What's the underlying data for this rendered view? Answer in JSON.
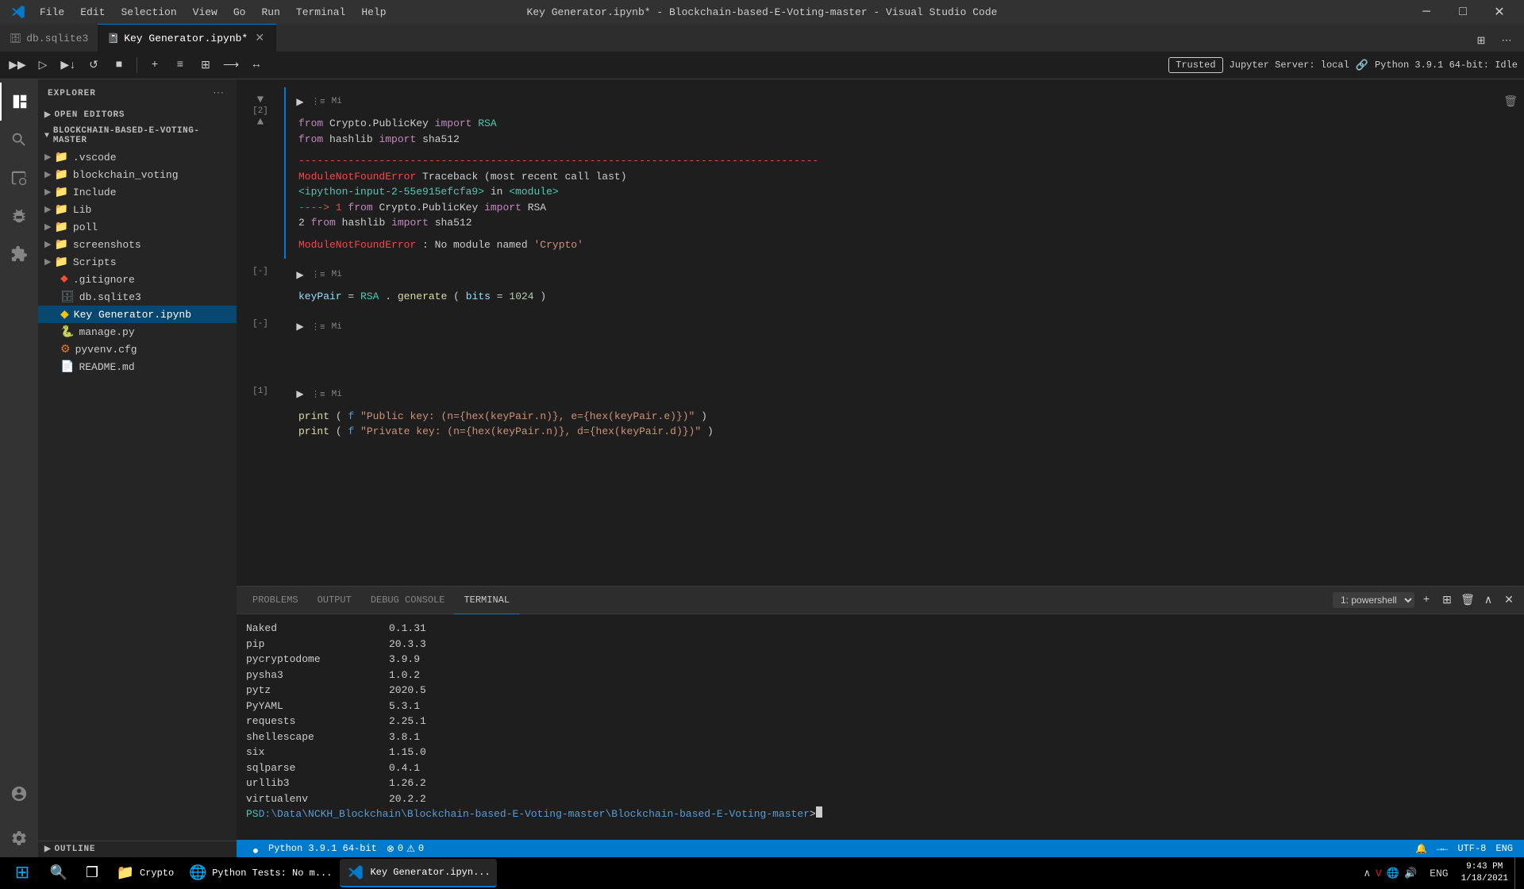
{
  "titleBar": {
    "title": "Key Generator.ipynb* - Blockchain-based-E-Voting-master - Visual Studio Code",
    "menuItems": [
      "File",
      "Edit",
      "Selection",
      "View",
      "Go",
      "Run",
      "Terminal",
      "Help"
    ],
    "windowControls": {
      "minimize": "─",
      "maximize": "□",
      "close": "✕"
    }
  },
  "tabs": {
    "items": [
      {
        "id": "db-tab",
        "label": "db.sqlite3",
        "icon": "🗄",
        "active": false,
        "modified": false
      },
      {
        "id": "keygen-tab",
        "label": "Key Generator.ipynb",
        "icon": "📓",
        "active": true,
        "modified": true
      }
    ],
    "rightActions": [
      "⋯",
      "⊞"
    ]
  },
  "notebookToolbar": {
    "buttons": [
      {
        "id": "run-all",
        "icon": "▶▶",
        "title": "Run All"
      },
      {
        "id": "run-above",
        "icon": "▶↑",
        "title": "Run Above"
      },
      {
        "id": "run-below",
        "icon": "▶↓",
        "title": "Run Below"
      },
      {
        "id": "restart",
        "icon": "↺",
        "title": "Restart"
      },
      {
        "id": "stop",
        "icon": "■",
        "title": "Stop"
      },
      {
        "id": "add-cell",
        "icon": "+",
        "title": "Add Cell"
      },
      {
        "id": "toggle-1",
        "icon": "≡",
        "title": "Toggle"
      },
      {
        "id": "toggle-2",
        "icon": "⊞",
        "title": "Toggle 2"
      },
      {
        "id": "toggle-3",
        "icon": "⟶",
        "title": "Toggle 3"
      },
      {
        "id": "split",
        "icon": "↔",
        "title": "Split"
      }
    ],
    "trusted": "Trusted",
    "jupyterServer": "Jupyter Server: local",
    "pythonVersion": "Python 3.9.1 64-bit: Idle"
  },
  "sidebar": {
    "title": "Explorer",
    "openEditorsSection": "Open Editors",
    "projectSection": "BLOCKCHAIN-BASED-E-VOTING-MASTER",
    "folders": [
      {
        "name": ".vscode",
        "type": "folder",
        "expanded": false
      },
      {
        "name": "blockchain_voting",
        "type": "folder",
        "expanded": false
      },
      {
        "name": "Include",
        "type": "folder",
        "expanded": false
      },
      {
        "name": "Lib",
        "type": "folder",
        "expanded": false
      },
      {
        "name": "poll",
        "type": "folder",
        "expanded": false
      },
      {
        "name": "screenshots",
        "type": "folder",
        "expanded": false
      },
      {
        "name": "Scripts",
        "type": "folder",
        "expanded": false
      }
    ],
    "files": [
      {
        "name": ".gitignore",
        "type": "git"
      },
      {
        "name": "db.sqlite3",
        "type": "db"
      },
      {
        "name": "Key Generator.ipynb",
        "type": "ipynb",
        "selected": true
      },
      {
        "name": "manage.py",
        "type": "py"
      },
      {
        "name": "pyvenv.cfg",
        "type": "cfg"
      },
      {
        "name": "README.md",
        "type": "md"
      }
    ],
    "outlineSection": "Outline",
    "addFileBtn": "+"
  },
  "cells": [
    {
      "id": "cell-2",
      "number": "[2]",
      "collapsed": false,
      "code": [
        "from Crypto.PublicKey import RSA",
        "from hashlib import sha512"
      ],
      "hasOutput": true,
      "output": {
        "separator": "------------------------------------------------------------------------------------",
        "errorType": "ModuleNotFoundError",
        "tracebackHeader": "Traceback (most recent call last)",
        "tracebackLocation": "<ipython-input-2-55e915efcfa9> in <module>",
        "arrow1": "----> 1 from Crypto.PublicKey import RSA",
        "line2": "      2 from hashlib import sha512",
        "emptyLine": "",
        "errorMsg": "ModuleNotFoundError: No module named 'Crypto'"
      }
    },
    {
      "id": "cell-minus1",
      "number": "[-]",
      "collapsed": false,
      "code": [
        "keyPair = RSA.generate(bits=1024)"
      ],
      "hasOutput": false
    },
    {
      "id": "cell-minus2",
      "number": "[-]",
      "collapsed": false,
      "code": [
        ""
      ],
      "hasOutput": false
    },
    {
      "id": "cell-1",
      "number": "[1]",
      "collapsed": false,
      "code": [
        "print(f\"Public key:  (n={hex(keyPair.n)}, e={hex(keyPair.e)})\")",
        "print(f\"Private key: (n={hex(keyPair.n)}, d={hex(keyPair.d)})\")"
      ],
      "hasOutput": false
    }
  ],
  "terminal": {
    "tabs": [
      "PROBLEMS",
      "OUTPUT",
      "DEBUG CONSOLE",
      "TERMINAL"
    ],
    "activeTab": "TERMINAL",
    "shellSelector": "1: powershell",
    "packages": [
      {
        "name": "Naked",
        "version": "0.1.31"
      },
      {
        "name": "pip",
        "version": "20.3.3"
      },
      {
        "name": "pycryptodome",
        "version": "3.9.9"
      },
      {
        "name": "pysha3",
        "version": "1.0.2"
      },
      {
        "name": "pytz",
        "version": "2020.5"
      },
      {
        "name": "PyYAML",
        "version": "5.3.1"
      },
      {
        "name": "requests",
        "version": "2.25.1"
      },
      {
        "name": "shellescape",
        "version": "3.8.1"
      },
      {
        "name": "six",
        "version": "1.15.0"
      },
      {
        "name": "sqlparse",
        "version": "0.4.1"
      },
      {
        "name": "urllib3",
        "version": "1.26.2"
      },
      {
        "name": "virtualenv",
        "version": "20.2.2"
      }
    ],
    "promptText": "PS D:\\Data\\NCKH_Blockchain\\Blockchain-based-E-Voting-master\\Blockchain-based-E-Voting-master>"
  },
  "statusBar": {
    "pythonVersion": "Python 3.9.1 64-bit",
    "errors": "0",
    "warnings": "0",
    "liveShare": "",
    "notifications": "",
    "encoding": "UTF-8",
    "language": "ENG"
  },
  "taskbar": {
    "items": [
      {
        "id": "windows",
        "icon": "⊞",
        "label": ""
      },
      {
        "id": "search",
        "icon": "🔍",
        "label": ""
      },
      {
        "id": "taskview",
        "icon": "❐",
        "label": ""
      },
      {
        "id": "explorer",
        "icon": "📁",
        "label": "Crypto",
        "active": false
      },
      {
        "id": "python-tests",
        "icon": "🐍",
        "label": "Python Tests: No m...",
        "active": false
      },
      {
        "id": "vscode",
        "icon": "⬡",
        "label": "Key Generator.ipyn...",
        "active": true
      }
    ],
    "clock": "9:43 PM",
    "date": "1/18/2021",
    "language": "ENG"
  }
}
